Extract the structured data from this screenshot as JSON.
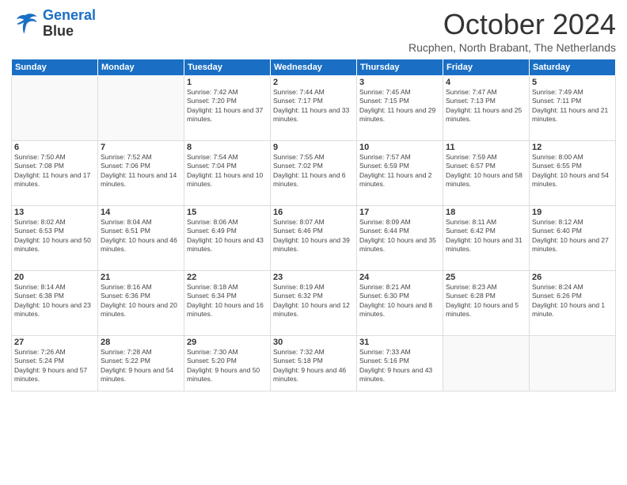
{
  "header": {
    "logo_line1": "General",
    "logo_line2": "Blue",
    "month_title": "October 2024",
    "location": "Rucphen, North Brabant, The Netherlands"
  },
  "weekdays": [
    "Sunday",
    "Monday",
    "Tuesday",
    "Wednesday",
    "Thursday",
    "Friday",
    "Saturday"
  ],
  "weeks": [
    [
      {
        "day": "",
        "empty": true
      },
      {
        "day": "",
        "empty": true
      },
      {
        "day": "1",
        "sunrise": "7:42 AM",
        "sunset": "7:20 PM",
        "daylight": "11 hours and 37 minutes."
      },
      {
        "day": "2",
        "sunrise": "7:44 AM",
        "sunset": "7:17 PM",
        "daylight": "11 hours and 33 minutes."
      },
      {
        "day": "3",
        "sunrise": "7:45 AM",
        "sunset": "7:15 PM",
        "daylight": "11 hours and 29 minutes."
      },
      {
        "day": "4",
        "sunrise": "7:47 AM",
        "sunset": "7:13 PM",
        "daylight": "11 hours and 25 minutes."
      },
      {
        "day": "5",
        "sunrise": "7:49 AM",
        "sunset": "7:11 PM",
        "daylight": "11 hours and 21 minutes."
      }
    ],
    [
      {
        "day": "6",
        "sunrise": "7:50 AM",
        "sunset": "7:08 PM",
        "daylight": "11 hours and 17 minutes."
      },
      {
        "day": "7",
        "sunrise": "7:52 AM",
        "sunset": "7:06 PM",
        "daylight": "11 hours and 14 minutes."
      },
      {
        "day": "8",
        "sunrise": "7:54 AM",
        "sunset": "7:04 PM",
        "daylight": "11 hours and 10 minutes."
      },
      {
        "day": "9",
        "sunrise": "7:55 AM",
        "sunset": "7:02 PM",
        "daylight": "11 hours and 6 minutes."
      },
      {
        "day": "10",
        "sunrise": "7:57 AM",
        "sunset": "6:59 PM",
        "daylight": "11 hours and 2 minutes."
      },
      {
        "day": "11",
        "sunrise": "7:59 AM",
        "sunset": "6:57 PM",
        "daylight": "10 hours and 58 minutes."
      },
      {
        "day": "12",
        "sunrise": "8:00 AM",
        "sunset": "6:55 PM",
        "daylight": "10 hours and 54 minutes."
      }
    ],
    [
      {
        "day": "13",
        "sunrise": "8:02 AM",
        "sunset": "6:53 PM",
        "daylight": "10 hours and 50 minutes."
      },
      {
        "day": "14",
        "sunrise": "8:04 AM",
        "sunset": "6:51 PM",
        "daylight": "10 hours and 46 minutes."
      },
      {
        "day": "15",
        "sunrise": "8:06 AM",
        "sunset": "6:49 PM",
        "daylight": "10 hours and 43 minutes."
      },
      {
        "day": "16",
        "sunrise": "8:07 AM",
        "sunset": "6:46 PM",
        "daylight": "10 hours and 39 minutes."
      },
      {
        "day": "17",
        "sunrise": "8:09 AM",
        "sunset": "6:44 PM",
        "daylight": "10 hours and 35 minutes."
      },
      {
        "day": "18",
        "sunrise": "8:11 AM",
        "sunset": "6:42 PM",
        "daylight": "10 hours and 31 minutes."
      },
      {
        "day": "19",
        "sunrise": "8:12 AM",
        "sunset": "6:40 PM",
        "daylight": "10 hours and 27 minutes."
      }
    ],
    [
      {
        "day": "20",
        "sunrise": "8:14 AM",
        "sunset": "6:38 PM",
        "daylight": "10 hours and 23 minutes."
      },
      {
        "day": "21",
        "sunrise": "8:16 AM",
        "sunset": "6:36 PM",
        "daylight": "10 hours and 20 minutes."
      },
      {
        "day": "22",
        "sunrise": "8:18 AM",
        "sunset": "6:34 PM",
        "daylight": "10 hours and 16 minutes."
      },
      {
        "day": "23",
        "sunrise": "8:19 AM",
        "sunset": "6:32 PM",
        "daylight": "10 hours and 12 minutes."
      },
      {
        "day": "24",
        "sunrise": "8:21 AM",
        "sunset": "6:30 PM",
        "daylight": "10 hours and 8 minutes."
      },
      {
        "day": "25",
        "sunrise": "8:23 AM",
        "sunset": "6:28 PM",
        "daylight": "10 hours and 5 minutes."
      },
      {
        "day": "26",
        "sunrise": "8:24 AM",
        "sunset": "6:26 PM",
        "daylight": "10 hours and 1 minute."
      }
    ],
    [
      {
        "day": "27",
        "sunrise": "7:26 AM",
        "sunset": "5:24 PM",
        "daylight": "9 hours and 57 minutes."
      },
      {
        "day": "28",
        "sunrise": "7:28 AM",
        "sunset": "5:22 PM",
        "daylight": "9 hours and 54 minutes."
      },
      {
        "day": "29",
        "sunrise": "7:30 AM",
        "sunset": "5:20 PM",
        "daylight": "9 hours and 50 minutes."
      },
      {
        "day": "30",
        "sunrise": "7:32 AM",
        "sunset": "5:18 PM",
        "daylight": "9 hours and 46 minutes."
      },
      {
        "day": "31",
        "sunrise": "7:33 AM",
        "sunset": "5:16 PM",
        "daylight": "9 hours and 43 minutes."
      },
      {
        "day": "",
        "empty": true
      },
      {
        "day": "",
        "empty": true
      }
    ]
  ]
}
